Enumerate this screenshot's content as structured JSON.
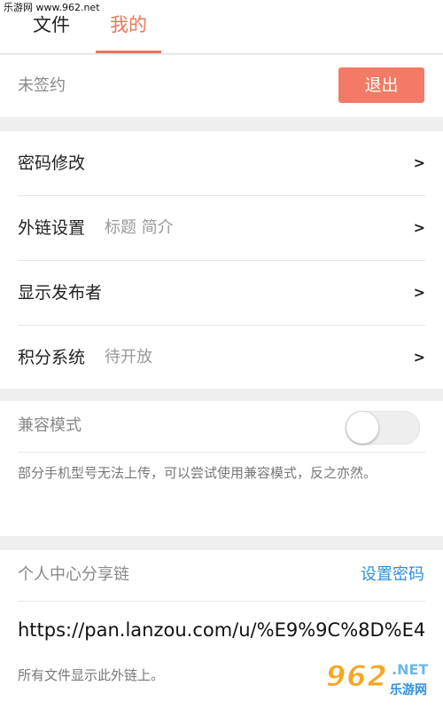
{
  "watermark": {
    "site": "乐游网 www.962.net",
    "logo_num": "962",
    "logo_net": ".NET",
    "logo_cn": "乐游网"
  },
  "tabs": [
    {
      "label": "文件"
    },
    {
      "label": "我的"
    }
  ],
  "account": {
    "status": "未签约",
    "logout_label": "退出"
  },
  "settings": {
    "rows": [
      {
        "label": "密码修改",
        "hint": "",
        "arrow": ">"
      },
      {
        "label": "外链设置",
        "hint": "标题 简介",
        "arrow": ">"
      },
      {
        "label": "显示发布者",
        "hint": "",
        "arrow": ">"
      },
      {
        "label": "积分系统",
        "hint": "待开放",
        "arrow": ">"
      }
    ]
  },
  "compat": {
    "label": "兼容模式",
    "enabled": false,
    "description": "部分手机型号无法上传，可以尝试使用兼容模式，反之亦然。"
  },
  "share": {
    "title": "个人中心分享链",
    "set_password_label": "设置密码",
    "url": "https://pan.lanzou.com/u/%E9%9C%8D%E4",
    "note": "所有文件显示此外链上。"
  },
  "colors": {
    "accent": "#e8765a",
    "button": "#f27a66",
    "link": "#2f8fdc"
  }
}
